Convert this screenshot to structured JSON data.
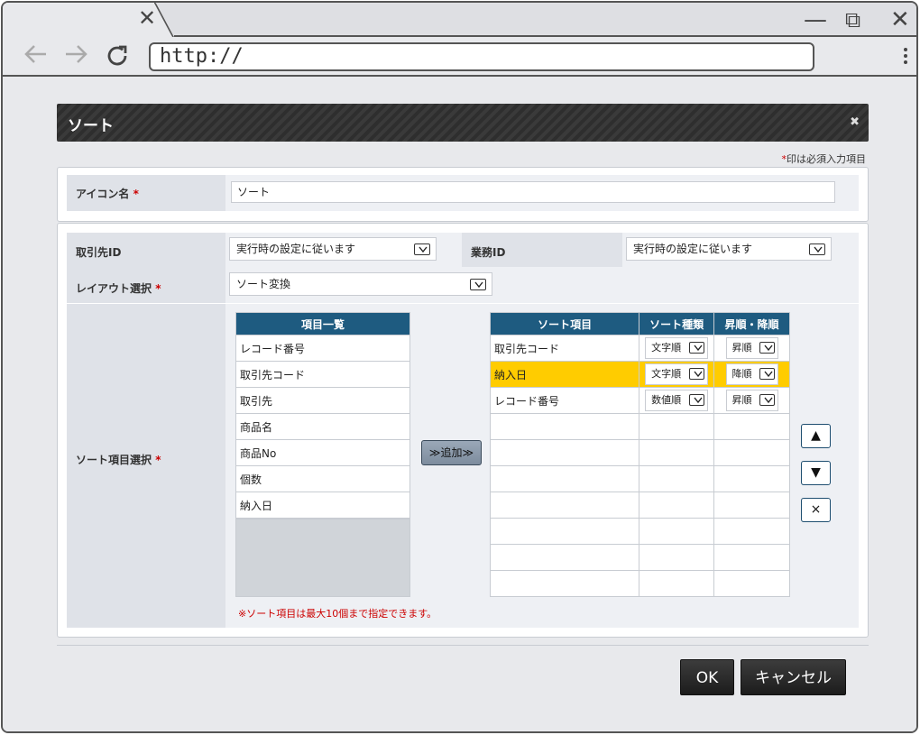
{
  "browser": {
    "tab_close": "✕",
    "url": "http://",
    "minimize": "—",
    "restore": "⧉",
    "close": "✕"
  },
  "dialog": {
    "title": "ソート",
    "close": "✖",
    "required_note_star": "*",
    "required_note": "印は必須入力項目",
    "fields": {
      "icon_name_label": "アイコン名",
      "icon_name_value": "ソート",
      "client_id_label": "取引先ID",
      "client_id_value": "実行時の設定に従います",
      "business_id_label": "業務ID",
      "business_id_value": "実行時の設定に従います",
      "layout_label": "レイアウト選択",
      "layout_value": "ソート変換",
      "sort_items_label": "ソート項目選択",
      "required_mark": "*"
    },
    "item_list": {
      "header": "項目一覧",
      "items": [
        "レコード番号",
        "取引先コード",
        "取引先",
        "商品名",
        "商品No",
        "個数",
        "納入日"
      ]
    },
    "add_button": "≫追加≫",
    "sort_table": {
      "headers": [
        "ソート項目",
        "ソート種類",
        "昇順・降順"
      ],
      "rows": [
        {
          "item": "取引先コード",
          "kind": "文字順",
          "order": "昇順",
          "highlighted": false
        },
        {
          "item": "納入日",
          "kind": "文字順",
          "order": "降順",
          "highlighted": true
        },
        {
          "item": "レコード番号",
          "kind": "数値順",
          "order": "昇順",
          "highlighted": false
        }
      ],
      "empty_rows": 7
    },
    "order_buttons": {
      "up": "▲",
      "down": "▼",
      "remove": "×"
    },
    "limit_note": "※ソート項目は最大10個まで指定できます。",
    "ok_button": "OK",
    "cancel_button": "キャンセル",
    "colors": {
      "header_blue": "#1e5b80",
      "highlight": "#ffcc00",
      "required": "#cc0000"
    }
  }
}
